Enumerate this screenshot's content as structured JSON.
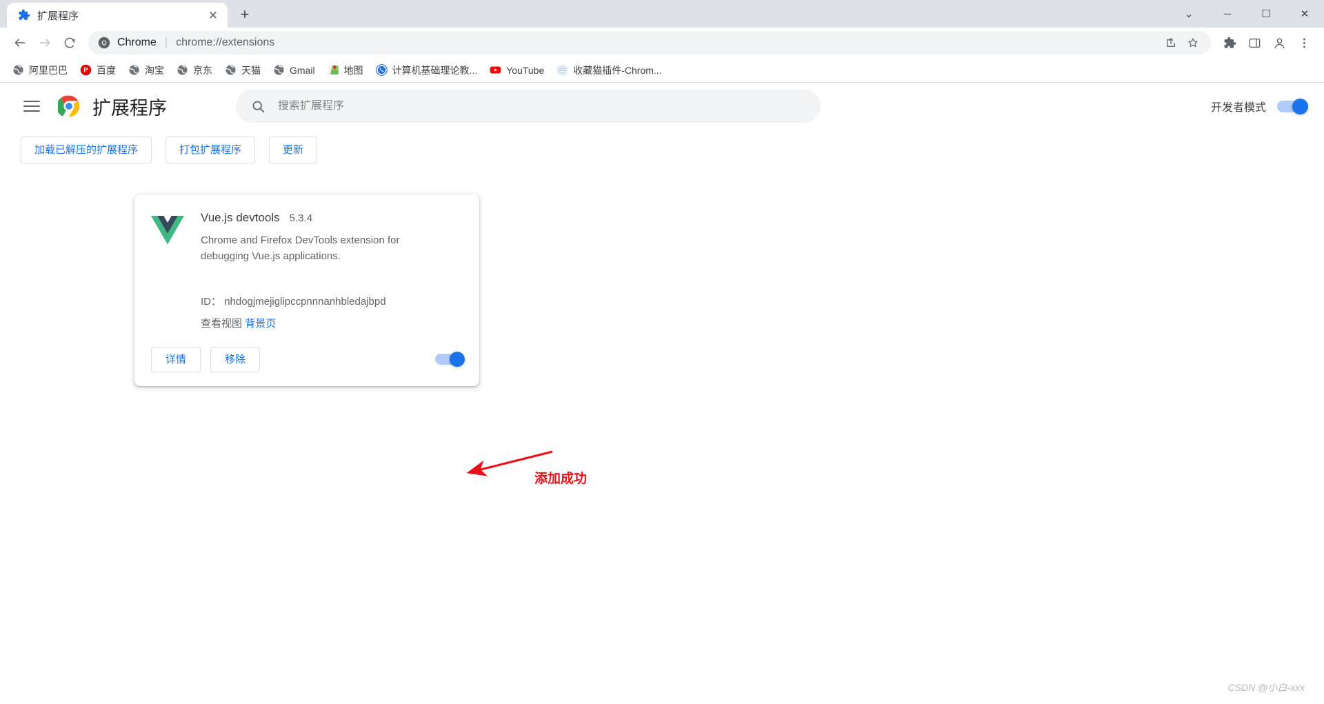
{
  "window": {
    "controls": {
      "minimize_label": "─",
      "maximize_label": "☐",
      "close_label": "✕",
      "collapse_label": "⌄"
    }
  },
  "tabstrip": {
    "tabs": [
      {
        "title": "扩展程序",
        "favicon": "puzzle-piece-icon",
        "close_label": "✕"
      }
    ],
    "new_tab_label": "+"
  },
  "toolbar": {
    "back_label": "←",
    "forward_label": "→",
    "reload_label": "⟳",
    "omnibox": {
      "site_icon": "chrome-icon",
      "scheme_label": "Chrome",
      "separator": "|",
      "url": "chrome://extensions"
    },
    "share_label": "⇧",
    "bookmark_label": "☆",
    "extensions_label": "🧩",
    "sidepanel_label": "▭",
    "profile_label": "👤",
    "menu_label": "⋮"
  },
  "bookmarks": [
    {
      "label": "阿里巴巴",
      "icon": "globe-icon"
    },
    {
      "label": "百度",
      "icon": "baidu-icon"
    },
    {
      "label": "淘宝",
      "icon": "globe-icon"
    },
    {
      "label": "京东",
      "icon": "globe-icon"
    },
    {
      "label": "天猫",
      "icon": "globe-icon"
    },
    {
      "label": "Gmail",
      "icon": "globe-icon"
    },
    {
      "label": "地图",
      "icon": "maps-icon"
    },
    {
      "label": "计算机基础理论教...",
      "icon": "blue-circle-icon"
    },
    {
      "label": "YouTube",
      "icon": "youtube-icon"
    },
    {
      "label": "收藏猫插件-Chrom...",
      "icon": "cat-icon"
    }
  ],
  "ext_header": {
    "menu_icon": "hamburger-icon",
    "logo_icon": "chrome-icon",
    "title": "扩展程序",
    "search": {
      "icon": "search-icon",
      "placeholder": "搜索扩展程序",
      "value": ""
    },
    "dev_mode": {
      "label": "开发者模式",
      "enabled": true
    }
  },
  "ext_actions": [
    {
      "label": "加载已解压的扩展程序",
      "name": "load-unpacked-button"
    },
    {
      "label": "打包扩展程序",
      "name": "pack-extension-button"
    },
    {
      "label": "更新",
      "name": "update-button"
    }
  ],
  "extensions": [
    {
      "icon": "vue-logo-icon",
      "name": "Vue.js devtools",
      "version": "5.3.4",
      "description": "Chrome and Firefox DevTools extension for debugging Vue.js applications.",
      "id_label": "ID：",
      "id_value": "nhdogjmejiglipccpnnnanhbledajbpd",
      "views_label": "查看视图",
      "views_link": "背景页",
      "details_label": "详情",
      "remove_label": "移除",
      "enabled": true
    }
  ],
  "annotation": {
    "text": "添加成功",
    "color": "#e8131a"
  },
  "watermark": "CSDN @小白-xxx",
  "colors": {
    "accent": "#1a73e8",
    "toggle_track": "#aecbfa",
    "tabstrip_bg": "#dee1e6",
    "omnibox_bg": "#f1f3f4",
    "annotation_red": "#e8131a"
  }
}
